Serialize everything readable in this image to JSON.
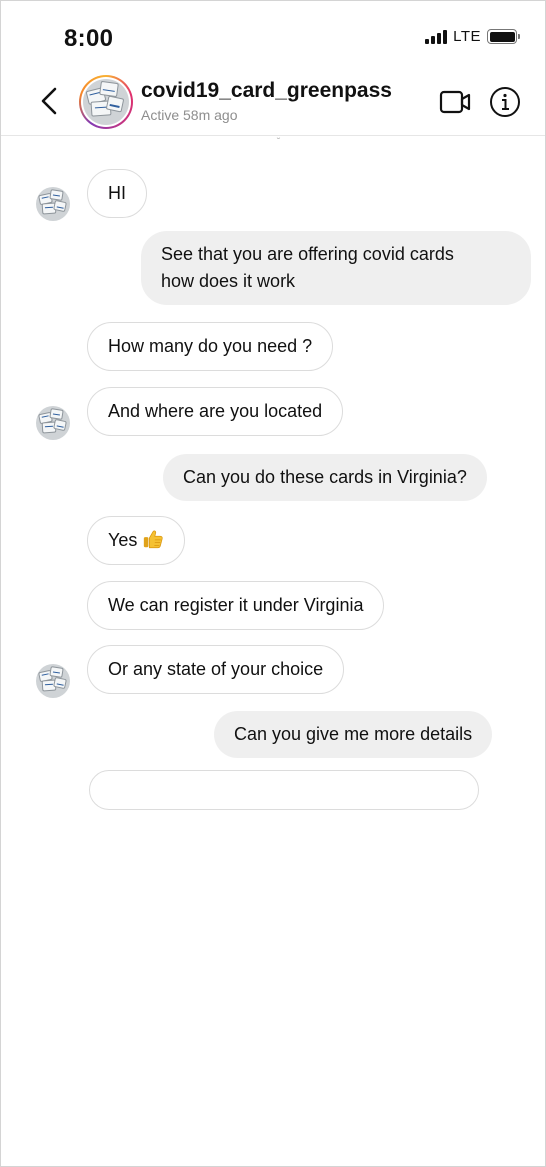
{
  "status_bar": {
    "time": "8:00",
    "network": "LTE",
    "icons": [
      "signal-icon",
      "battery-icon"
    ]
  },
  "header": {
    "username": "covid19_card_greenpass",
    "activity": "Active 58m ago",
    "icons": [
      "back-icon",
      "video-call-icon",
      "info-icon"
    ]
  },
  "messages": [
    {
      "sender": "them",
      "text": "HI"
    },
    {
      "sender": "me",
      "lines": [
        "See that you are offering covid cards",
        "how does it work"
      ]
    },
    {
      "sender": "them",
      "text": "How many do you need ?"
    },
    {
      "sender": "them",
      "text": "And where are you located"
    },
    {
      "sender": "me",
      "text": "Can you do these cards in Virginia?"
    },
    {
      "sender": "them",
      "text": "Yes",
      "emoji": "thumbs-up-icon"
    },
    {
      "sender": "them",
      "text": "We can register it under Virginia"
    },
    {
      "sender": "them",
      "text": "Or any state of your choice"
    },
    {
      "sender": "me",
      "text": "Can you give me more details"
    }
  ],
  "colors": {
    "incoming_bubble_border": "#dcdcdc",
    "outgoing_bubble": "#efefef",
    "secondary_text": "#8e8e8e",
    "avatar_ring": [
      "#f9b233",
      "#e1306c",
      "#833ab4"
    ]
  }
}
